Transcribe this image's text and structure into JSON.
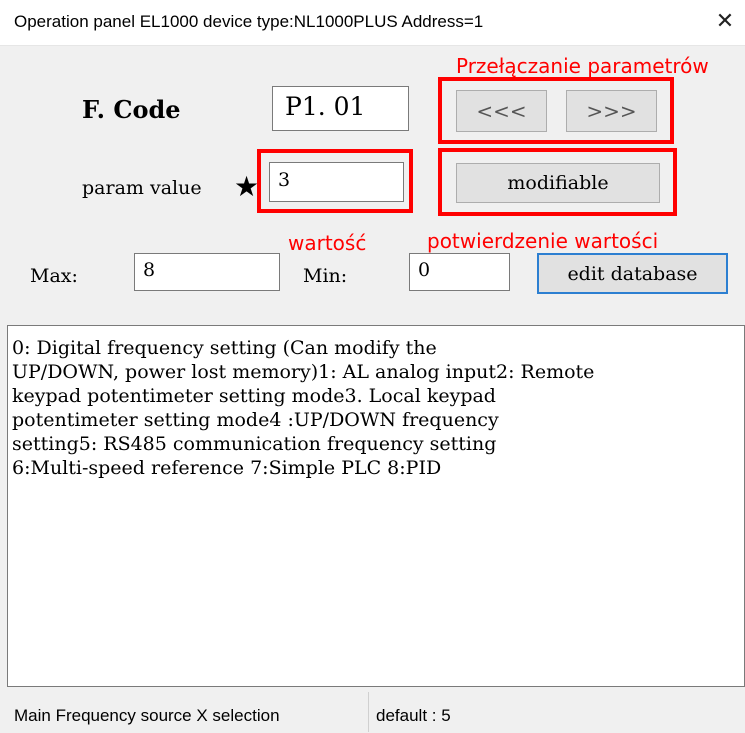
{
  "window": {
    "title": "Operation panel EL1000 device type:NL1000PLUS  Address=1",
    "close_glyph": "✕"
  },
  "form": {
    "fcode_label": "F. Code",
    "fcode_value": "P1. 01",
    "prev_label": "<<<",
    "next_label": ">>>",
    "param_label": "param value",
    "star_glyph": "★",
    "param_value": "3",
    "modify_label": "modifiable",
    "max_label": "Max:",
    "max_value": "8",
    "min_label": "Min:",
    "min_value": "0",
    "edit_label": "edit database"
  },
  "annotations": {
    "params": "Przełączanie parametrów",
    "value": "wartość",
    "confirm": "potwierdzenie wartości",
    "color": "#ff0000"
  },
  "description": {
    "lines": [
      "0: Digital frequency setting (Can modify the",
      "UP/DOWN, power lost memory)1: AL analog input2: Remote",
      "keypad potentimeter setting mode3. Local keypad",
      "potentimeter setting mode4 :UP/DOWN frequency",
      "setting5: RS485 communication frequency setting",
      "6:Multi-speed reference  7:Simple PLC   8:PID"
    ]
  },
  "status": {
    "left": "Main Frequency source X selection",
    "right": "default : 5"
  }
}
